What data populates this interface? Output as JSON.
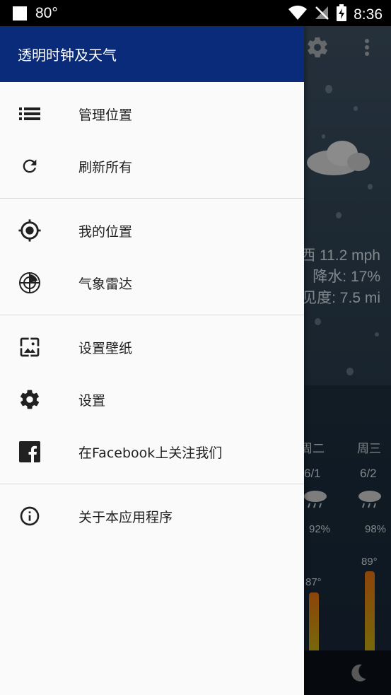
{
  "status_bar": {
    "temperature": "80°",
    "time": "8:36"
  },
  "background": {
    "wind": "西 11.2 mph",
    "precip": "降水: 17%",
    "visibility": "见度: 7.5 mi",
    "forecast": [
      {
        "day": "周二",
        "date": "6/1",
        "humidity": "92%",
        "temp": "87°"
      },
      {
        "day": "周三",
        "date": "6/2",
        "humidity": "98%",
        "temp": "89°"
      }
    ]
  },
  "drawer": {
    "title": "透明时钟及天气",
    "sections": [
      [
        {
          "icon": "list-icon",
          "label": "管理位置"
        },
        {
          "icon": "refresh-icon",
          "label": "刷新所有"
        }
      ],
      [
        {
          "icon": "gps-icon",
          "label": "我的位置"
        },
        {
          "icon": "radar-icon",
          "label": "气象雷达"
        }
      ],
      [
        {
          "icon": "wallpaper-icon",
          "label": "设置壁纸"
        },
        {
          "icon": "gear-icon",
          "label": "设置"
        },
        {
          "icon": "facebook-icon",
          "label": "在Facebook上关注我们"
        }
      ],
      [
        {
          "icon": "info-icon",
          "label": "关于本应用程序"
        }
      ]
    ]
  }
}
